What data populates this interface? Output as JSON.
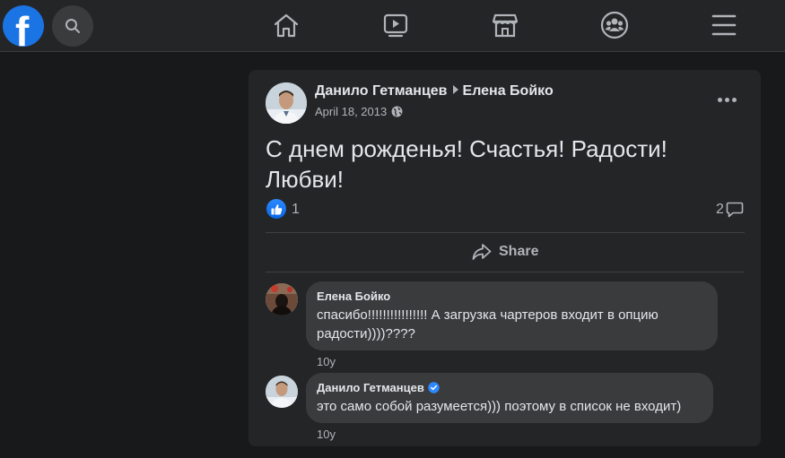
{
  "nav": {
    "logo_letter": "f",
    "icons": [
      "search-icon",
      "home-icon",
      "watch-icon",
      "marketplace-icon",
      "groups-icon",
      "menu-icon"
    ]
  },
  "post": {
    "author": "Данило Гетманцев",
    "recipient": "Елена Бойко",
    "date": "April 18, 2013",
    "text": "С днем рожденья! Счастья! Радости! Любви!",
    "like_count": "1",
    "comment_count": "2",
    "share_label": "Share"
  },
  "comments": [
    {
      "author": "Елена Бойко",
      "text": "спасибо!!!!!!!!!!!!!!!! А загрузка чартеров входит в опцию радости))))????",
      "time": "10y",
      "verified": false
    },
    {
      "author": "Данило Гетманцев",
      "text": "это само собой разумеется))) поэтому в список не входит)",
      "time": "10y",
      "verified": true
    }
  ],
  "colors": {
    "accent": "#1b74e4",
    "background": "#18191a",
    "card": "#242526",
    "bubble": "#3a3b3c"
  }
}
